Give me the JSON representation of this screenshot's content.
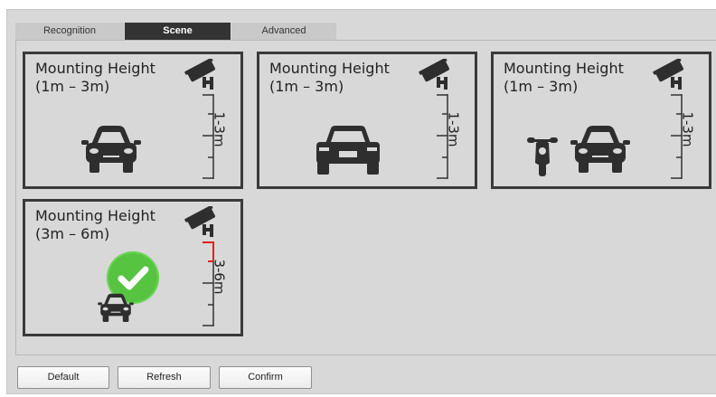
{
  "tabs": [
    {
      "label": "Recognition",
      "active": false
    },
    {
      "label": "Scene",
      "active": true
    },
    {
      "label": "Advanced",
      "active": false
    }
  ],
  "scenes": [
    {
      "title": "Mounting Height",
      "range": "(1m – 3m)",
      "ruler_label": "1-3m",
      "vehicles": [
        "car-front"
      ],
      "selected": false
    },
    {
      "title": "Mounting Height",
      "range": "(1m – 3m)",
      "ruler_label": "1-3m",
      "vehicles": [
        "car-rear"
      ],
      "selected": false
    },
    {
      "title": "Mounting Height",
      "range": "(1m – 3m)",
      "ruler_label": "1-3m",
      "vehicles": [
        "motorcycle",
        "car-front"
      ],
      "selected": false
    },
    {
      "title": "Mounting Height",
      "range": "(3m – 6m)",
      "ruler_label": "3-6m",
      "vehicles": [
        "car-front"
      ],
      "selected": true
    }
  ],
  "buttons": {
    "default": "Default",
    "refresh": "Refresh",
    "confirm": "Confirm"
  },
  "colors": {
    "active_tab": "#333333",
    "check_green": "#56c341",
    "ruler_highlight": "#e02020"
  }
}
